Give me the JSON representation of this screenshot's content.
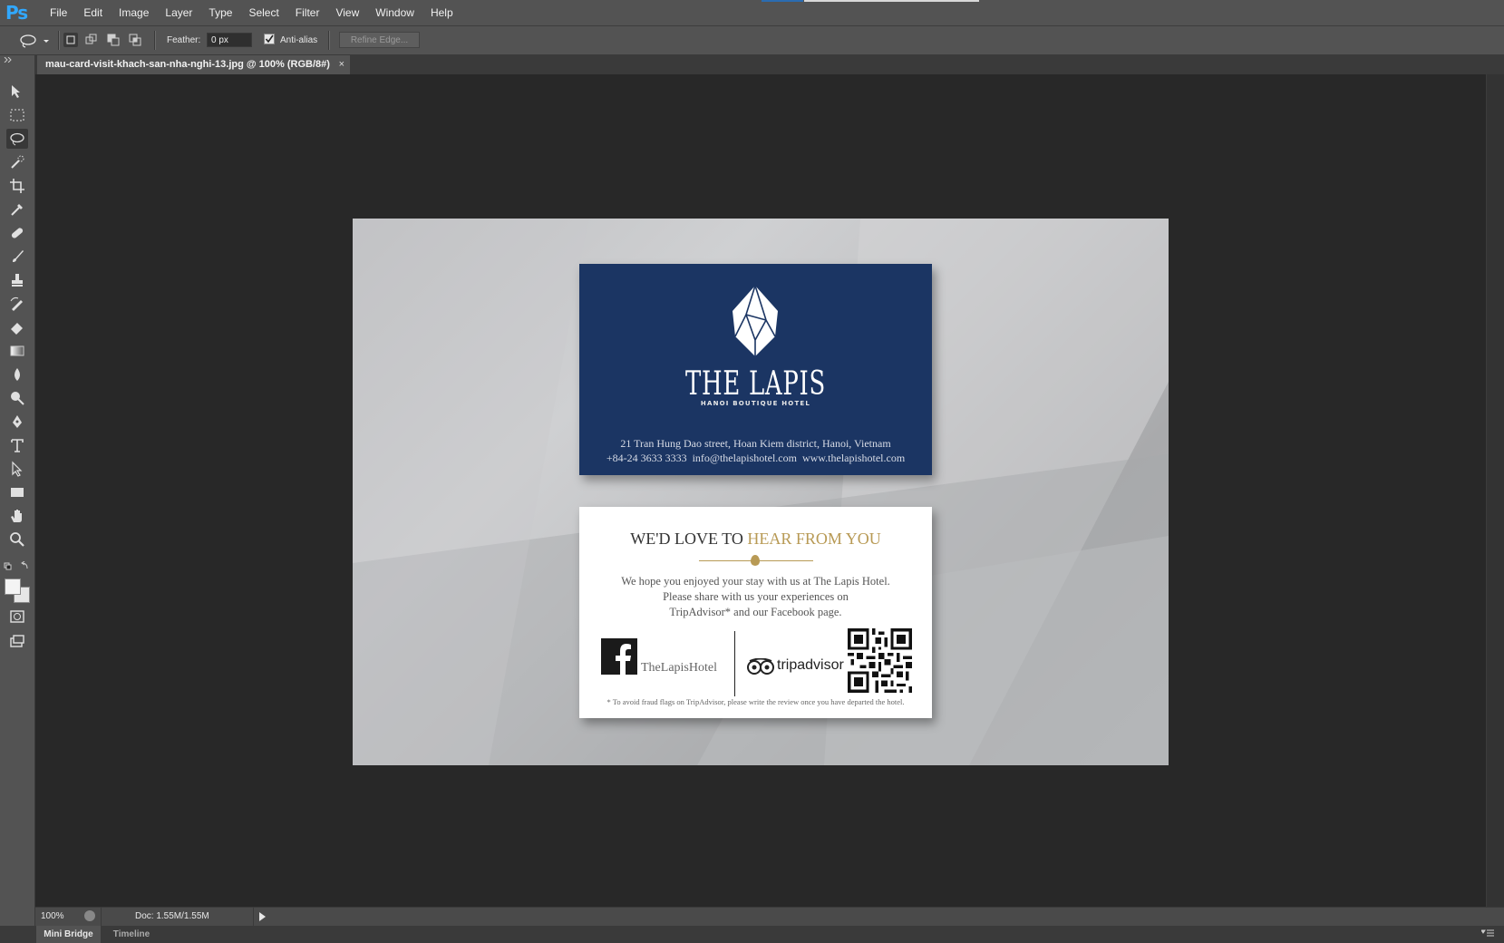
{
  "app": {
    "logo": "Ps"
  },
  "menu": [
    "File",
    "Edit",
    "Image",
    "Layer",
    "Type",
    "Select",
    "Filter",
    "View",
    "Window",
    "Help"
  ],
  "options": {
    "feather_label": "Feather:",
    "feather_value": "0 px",
    "antialias_label": "Anti-alias",
    "antialias_checked": true,
    "refine_edge_label": "Refine Edge..."
  },
  "tools": [
    "move-tool",
    "marquee-tool",
    "lasso-tool",
    "quick-selection-tool",
    "crop-tool",
    "eyedropper-tool",
    "healing-brush-tool",
    "brush-tool",
    "clone-stamp-tool",
    "history-brush-tool",
    "eraser-tool",
    "gradient-tool",
    "blur-tool",
    "dodge-tool",
    "pen-tool",
    "type-tool",
    "path-selection-tool",
    "rectangle-tool",
    "hand-tool",
    "zoom-tool"
  ],
  "document": {
    "tab_title": "mau-card-visit-khach-san-nha-nghi-13.jpg @ 100% (RGB/8#)",
    "close_glyph": "×"
  },
  "card_front": {
    "brand": "THE LAPIS",
    "subtitle": "HANOI BOUTIQUE HOTEL",
    "address": "21 Tran Hung Dao street, Hoan Kiem district, Hanoi, Vietnam",
    "contacts": "+84-24 3633 3333  info@thelapishotel.com  www.thelapishotel.com"
  },
  "card_back": {
    "headline_dark": "WE'D LOVE TO",
    "headline_gold": "HEAR FROM YOU",
    "message": [
      "We hope you enjoyed your stay with us at The Lapis Hotel.",
      "Please share with us your experiences on",
      "TripAdvisor* and our Facebook page."
    ],
    "facebook_handle": "TheLapisHotel",
    "tripadvisor_label": "tripadvisor",
    "footnote": "* To avoid fraud flags on TripAdvisor, please write the review once you have departed the hotel."
  },
  "status": {
    "zoom": "100%",
    "doc_size": "Doc: 1.55M/1.55M"
  },
  "bottom_tabs": [
    "Mini Bridge",
    "Timeline"
  ],
  "colors": {
    "accent": "#31a8ff",
    "card_navy": "#1b3563",
    "gold": "#b89a55"
  }
}
